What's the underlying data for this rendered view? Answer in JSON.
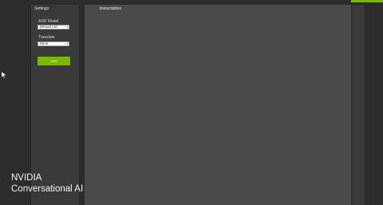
{
  "settings": {
    "title": "Settings",
    "asr_model": {
      "label": "ASR Model",
      "value": "Default LM"
    },
    "translate": {
      "label": "Translate",
      "value": "None"
    },
    "action_button_label": "Live"
  },
  "transcription": {
    "header": "transcription"
  },
  "brand": {
    "line1": "NVIDIA",
    "line2": "Conversational AI"
  },
  "colors": {
    "accent": "#76b900",
    "background": "#2d2d2d",
    "panel": "#3a3a3a",
    "transcription_panel": "#4a4a4a"
  },
  "icons": {
    "cursor": "mouse-pointer-icon",
    "dropdown": "chevron-down-icon"
  }
}
